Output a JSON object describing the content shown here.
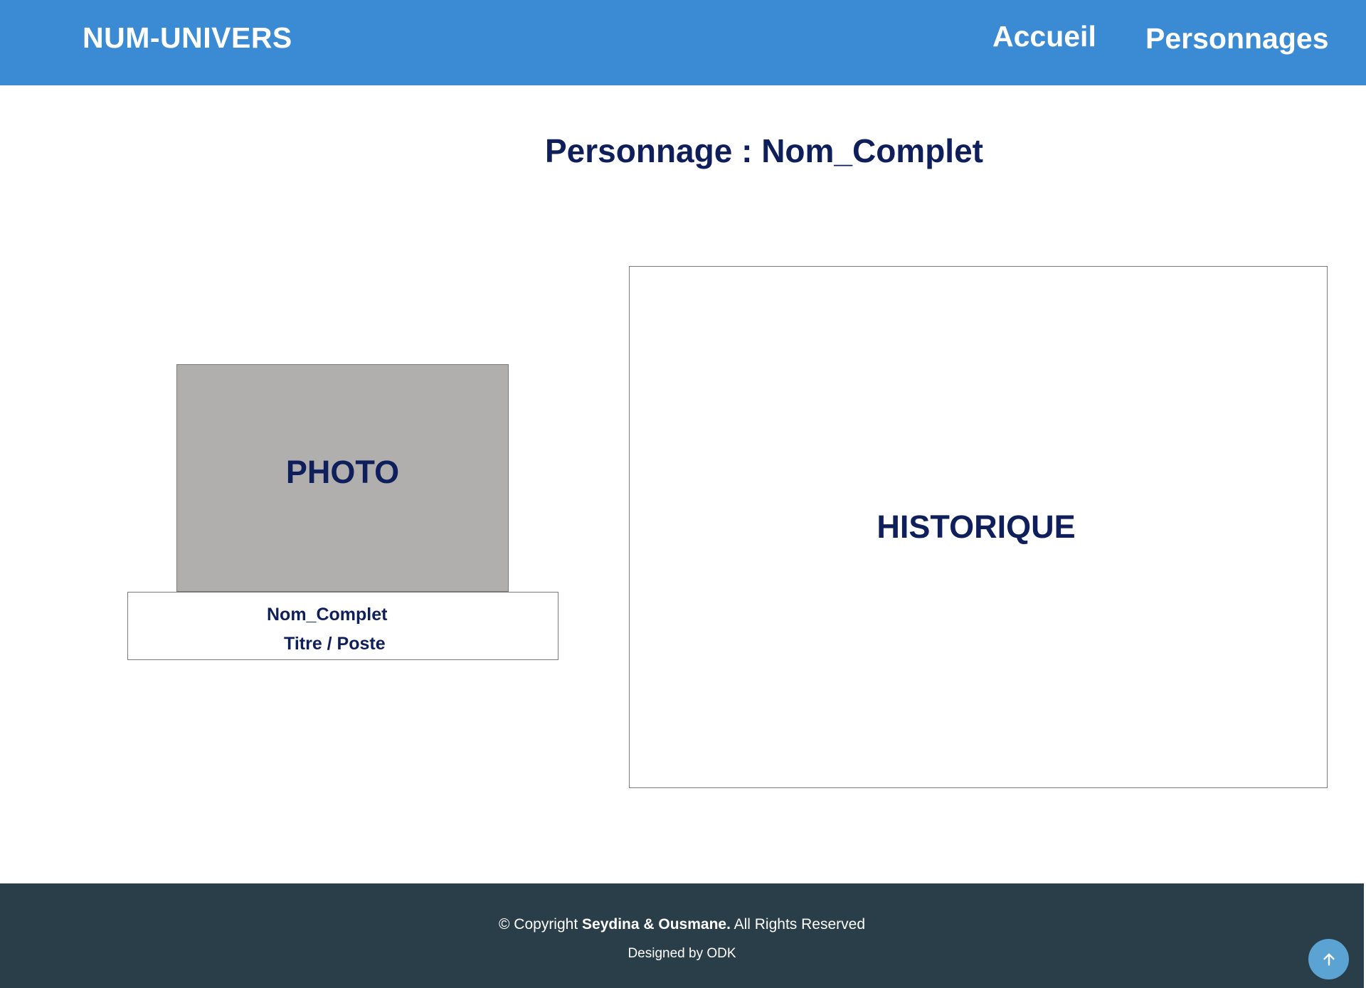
{
  "header": {
    "brand": "NUM-UNIVERS",
    "nav": {
      "home": "Accueil",
      "characters": "Personnages"
    }
  },
  "main": {
    "title": "Personnage : Nom_Complet",
    "photo": {
      "placeholder": "PHOTO",
      "name": "Nom_Complet",
      "role": "Titre / Poste"
    },
    "history": {
      "placeholder": "HISTORIQUE"
    }
  },
  "footer": {
    "copyright_prefix": "© Copyright ",
    "copyright_owner": "Seydina & Ousmane.",
    "copyright_suffix": " All Rights Reserved",
    "designed_by": "Designed by ODK"
  },
  "back_to_top": {
    "icon": "arrow-up-icon"
  },
  "colors": {
    "header_bg": "#3b8bd4",
    "title_text": "#0f1f5c",
    "photo_bg": "#b1aeae",
    "footer_bg": "#2a3e4a",
    "back_to_top_bg": "#5aa3d2"
  }
}
